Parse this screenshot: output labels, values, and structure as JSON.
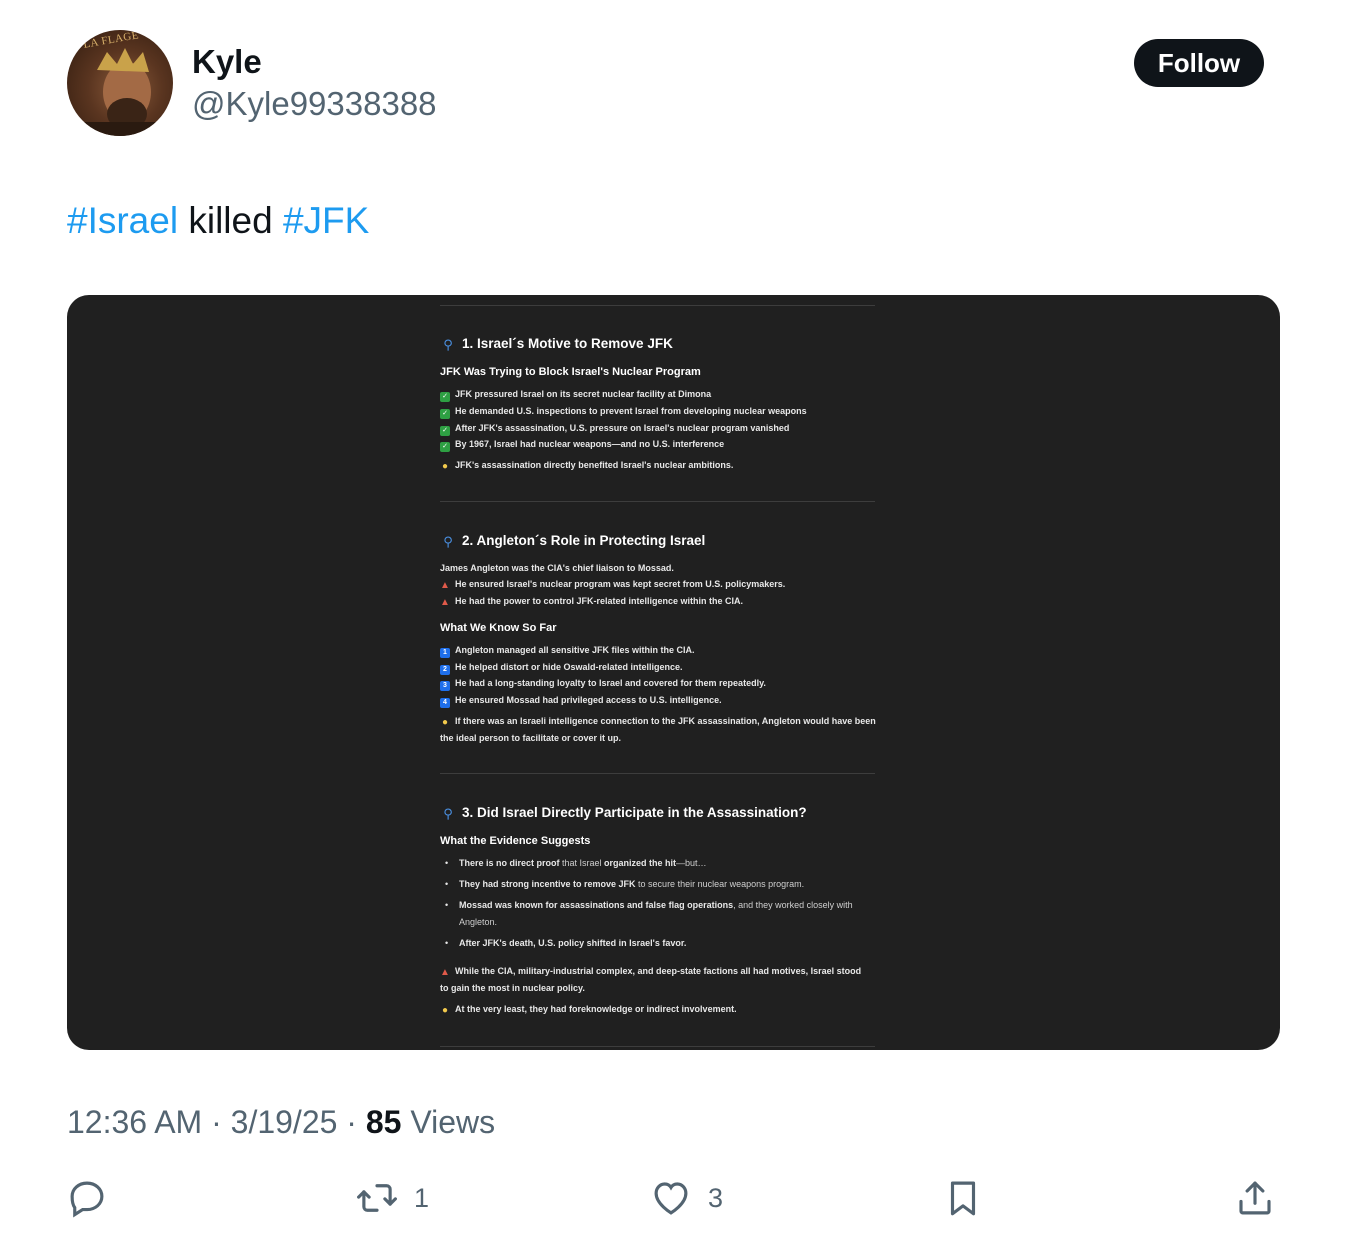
{
  "user": {
    "display_name": "Kyle",
    "handle": "@Kyle99338388",
    "avatar_text": "LA FLAGE"
  },
  "follow_label": "Follow",
  "tweet": {
    "hashtag1": "#Israel",
    "middle": " killed ",
    "hashtag2": "#JFK"
  },
  "image": {
    "s1": {
      "title": "1. Israel´s Motive to Remove JFK",
      "subtitle": "JFK Was Trying to Block Israel's Nuclear Program",
      "items": [
        "JFK pressured Israel on its secret nuclear facility at Dimona",
        "He demanded U.S. inspections to prevent Israel from developing nuclear weapons",
        "After JFK's assassination, U.S. pressure on Israel's nuclear program vanished",
        "By 1967, Israel had nuclear weapons—and no U.S. interference"
      ],
      "conclusion": "JFK's assassination directly benefited Israel's nuclear ambitions."
    },
    "s2": {
      "title": "2. Angleton´s Role in Protecting Israel",
      "intro": "James Angleton was the CIA's chief liaison to Mossad.",
      "alerts": [
        "He ensured Israel's nuclear program was kept secret from U.S. policymakers.",
        "He had the power to control JFK-related intelligence within the CIA."
      ],
      "subtitle": "What We Know So Far",
      "numbered": [
        {
          "num": "1",
          "text": "Angleton managed all sensitive JFK files within the CIA."
        },
        {
          "num": "2",
          "text": "He helped distort or hide Oswald-related intelligence."
        },
        {
          "num": "3",
          "text": "He had a long-standing loyalty to Israel and covered for them repeatedly."
        },
        {
          "num": "4",
          "text": "He ensured Mossad had privileged access to U.S. intelligence."
        }
      ],
      "conclusion_l1": "If there was an Israeli intelligence connection to the JFK assassination, Angleton would have been",
      "conclusion_l2": "the ideal person to facilitate or cover it up."
    },
    "s3": {
      "title": "3. Did Israel Directly Participate in the Assassination?",
      "subtitle": "What the Evidence Suggests",
      "b1_bold1": "There is no direct proof",
      "b1_norm": " that Israel ",
      "b1_bold2": "organized the hit",
      "b1_tail": "—but…",
      "b2_bold": "They had strong incentive to remove JFK",
      "b2_norm": " to secure their nuclear weapons program.",
      "b3_bold": "Mossad was known for assassinations and false flag operations",
      "b3_norm": ", and they worked closely with",
      "b3_l2": "Angleton.",
      "b4": "After JFK's death, U.S. policy shifted in Israel's favor.",
      "alert_l1": "While the CIA, military-industrial complex, and deep-state factions all had motives, Israel stood",
      "alert_l2": "to gain the most in nuclear policy.",
      "conclusion": "At the very least, they had foreknowledge or indirect involvement."
    }
  },
  "meta": {
    "time": "12:36 AM",
    "sep1": " · ",
    "date": "3/19/25",
    "sep2": " · ",
    "views_count": "85",
    "views_label": " Views"
  },
  "actions": {
    "retweets": "1",
    "likes": "3"
  },
  "icons": {
    "reply": "reply-icon",
    "retweet": "retweet-icon",
    "like": "heart-icon",
    "bookmark": "bookmark-icon",
    "share": "share-icon",
    "section_marker": "magnifier-icon",
    "check": "check-icon",
    "alert": "siren-icon",
    "tip": "lightbulb-icon"
  },
  "colors": {
    "link": "#1d9bf0",
    "text": "#0f1419",
    "muted": "#536471",
    "media_bg": "#202020"
  }
}
